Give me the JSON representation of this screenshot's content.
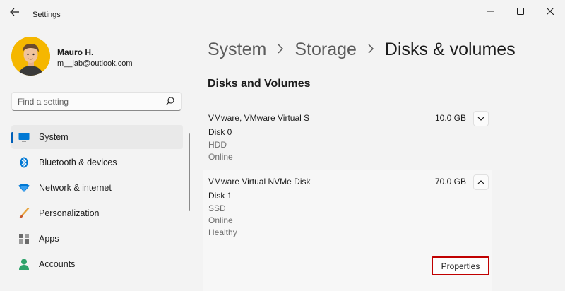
{
  "window": {
    "title": "Settings"
  },
  "profile": {
    "name": "Mauro H.",
    "email": "m__lab@outlook.com"
  },
  "search": {
    "placeholder": "Find a setting"
  },
  "sidebar": {
    "items": [
      {
        "label": "System",
        "icon": "monitor-icon",
        "active": true
      },
      {
        "label": "Bluetooth & devices",
        "icon": "bluetooth-icon",
        "active": false
      },
      {
        "label": "Network & internet",
        "icon": "wifi-icon",
        "active": false
      },
      {
        "label": "Personalization",
        "icon": "brush-icon",
        "active": false
      },
      {
        "label": "Apps",
        "icon": "apps-icon",
        "active": false
      },
      {
        "label": "Accounts",
        "icon": "person-icon",
        "active": false
      }
    ]
  },
  "breadcrumb": {
    "parts": [
      "System",
      "Storage"
    ],
    "current": "Disks & volumes"
  },
  "main": {
    "section_title": "Disks and Volumes",
    "disks": [
      {
        "name": "VMware, VMware Virtual S",
        "size": "10.0 GB",
        "expanded": false,
        "disk_label": "Disk 0",
        "lines": [
          "HDD",
          "Online"
        ]
      },
      {
        "name": "VMware Virtual NVMe Disk",
        "size": "70.0 GB",
        "expanded": true,
        "disk_label": "Disk 1",
        "lines": [
          "SSD",
          "Online",
          "Healthy"
        ]
      }
    ],
    "properties_label": "Properties"
  },
  "colors": {
    "accent": "#005fb8",
    "highlight_border": "#c00000"
  }
}
